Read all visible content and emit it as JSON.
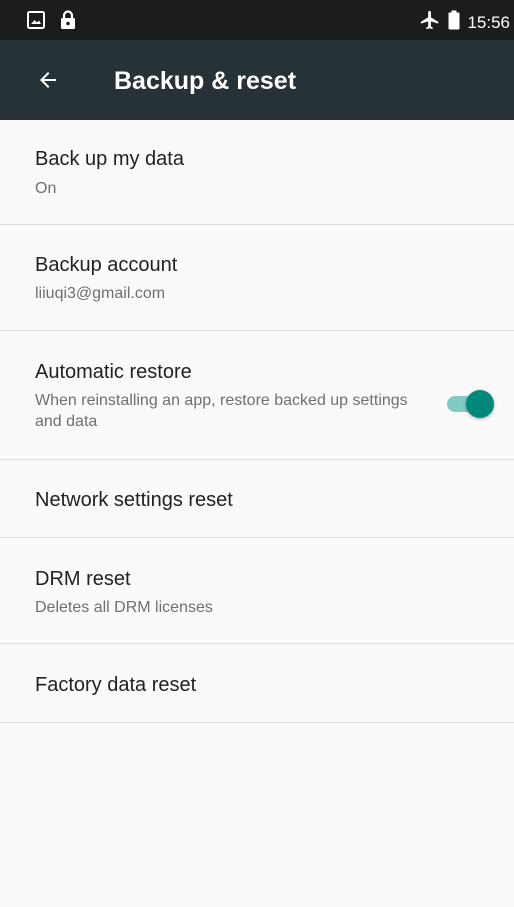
{
  "status_bar": {
    "time": "15:56",
    "icons": [
      "image-notification-icon",
      "lock-icon",
      "airplane-mode-icon",
      "battery-icon"
    ]
  },
  "app_bar": {
    "title": "Backup & reset",
    "back_icon": "arrow-back-icon"
  },
  "colors": {
    "status_bar": "#1a1c1e",
    "app_bar": "#263238",
    "background": "#fafafa",
    "toggle_thumb": "#00897b",
    "toggle_track": "#80cbc4"
  },
  "items": [
    {
      "title": "Back up my data",
      "summary": "On"
    },
    {
      "title": "Backup account",
      "summary": "liiuqi3@gmail.com"
    },
    {
      "title": "Automatic restore",
      "summary": "When reinstalling an app, restore backed up settings and data",
      "toggle_on": true
    },
    {
      "title": "Network settings reset"
    },
    {
      "title": "DRM reset",
      "summary": "Deletes all DRM licenses"
    },
    {
      "title": "Factory data reset"
    }
  ]
}
